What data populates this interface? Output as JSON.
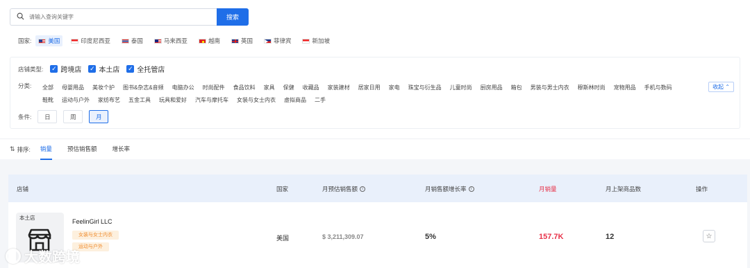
{
  "search": {
    "placeholder": "请输入查询关键字",
    "button": "搜索"
  },
  "country": {
    "label": "国家:",
    "items": [
      {
        "label": "美国",
        "active": true
      },
      {
        "label": "印度尼西亚",
        "active": false
      },
      {
        "label": "泰国",
        "active": false
      },
      {
        "label": "马来西亚",
        "active": false
      },
      {
        "label": "越南",
        "active": false
      },
      {
        "label": "英国",
        "active": false
      },
      {
        "label": "菲律宾",
        "active": false
      },
      {
        "label": "新加坡",
        "active": false
      }
    ]
  },
  "shop_type": {
    "label": "店铺类型:",
    "options": [
      "跨境店",
      "本土店",
      "全托管店"
    ]
  },
  "category": {
    "label": "分类:",
    "items": [
      "全部",
      "母婴用品",
      "美妆个护",
      "图书&杂志&音频",
      "电脑办公",
      "时尚配件",
      "食品饮料",
      "家具",
      "保健",
      "收藏品",
      "家装建材",
      "居家日用",
      "家电",
      "珠宝与衍生品",
      "儿童时尚",
      "厨房用品",
      "箱包",
      "男装与男士内衣",
      "穆斯林时尚",
      "宠物用品",
      "手机与数码",
      "鞋靴",
      "运动与户外",
      "家纺布艺",
      "五金工具",
      "玩具和爱好",
      "汽车与摩托车",
      "女装与女士内衣",
      "虚拟商品",
      "二手"
    ],
    "collapse": "收起"
  },
  "condition": {
    "label": "条件:",
    "options": [
      "日",
      "周",
      "月"
    ],
    "active": "月"
  },
  "sort": {
    "label": "排序:",
    "tabs": [
      "销量",
      "预估销售额",
      "增长率"
    ],
    "active": "销量"
  },
  "table": {
    "headers": [
      "店铺",
      "国家",
      "月预估销售额",
      "月销售额增长率",
      "月销量",
      "月上架商品数",
      "操作"
    ],
    "rows": [
      {
        "shop_type_tag": "本土店",
        "name": "FeelinGirl LLC",
        "tags": [
          "女装与女士内衣",
          "运动与户外"
        ],
        "country": "美国",
        "est_sales": "$ 3,211,309.07",
        "growth": "5%",
        "monthly_sales": "157.7K",
        "listed_products": "12"
      }
    ]
  },
  "watermark": "大数跨境",
  "colors": {
    "accent": "#1f6ee8",
    "highlight": "#e8334a",
    "tag": "#f08c2e"
  }
}
